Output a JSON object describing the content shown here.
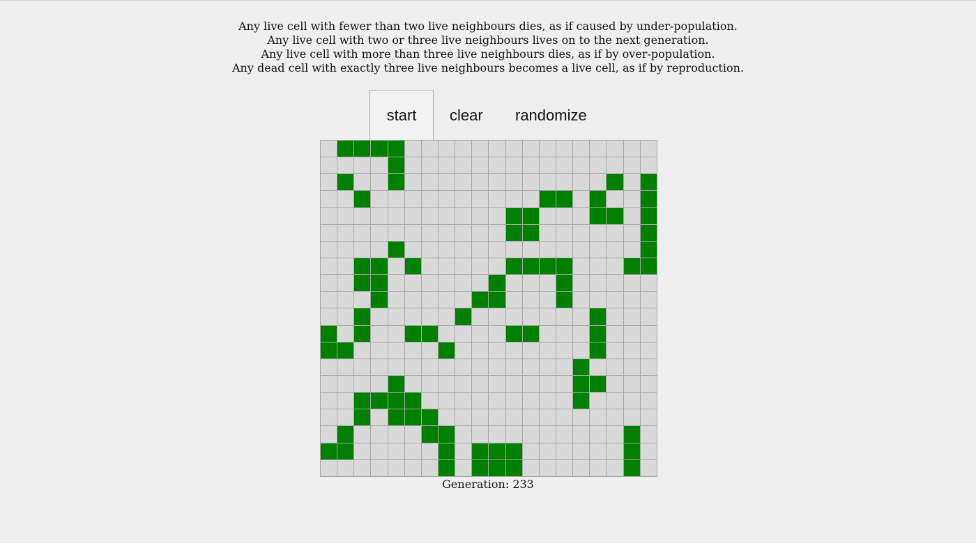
{
  "rules": [
    "Any live cell with fewer than two live neighbours dies, as if caused by under-population.",
    "Any live cell with two or three live neighbours lives on to the next generation.",
    "Any live cell with more than three live neighbours dies, as if by over-population.",
    "Any dead cell with exactly three live neighbours becomes a live cell, as if by reproduction."
  ],
  "controls": {
    "start_label": "start",
    "clear_label": "clear",
    "randomize_label": "randomize"
  },
  "board": {
    "rows": 20,
    "cols": 20,
    "alive_color": "#008000",
    "dead_color": "#d9d9d9",
    "grid_line_color": "#a6a6a6",
    "cells": [
      "01111000000000000000",
      "00001000000000000000",
      "01001000000000000101",
      "00100000000001101001",
      "00000000000110001101",
      "00000000000110000001",
      "00001000000000000001",
      "00110100000111100011",
      "00110000001000100000",
      "00010000011000100000",
      "00100000100000001000",
      "10100110000110001000",
      "11000001000000001000",
      "00000000000000010000",
      "00001000000000011000",
      "00111100000000010000",
      "00101110000000000000",
      "01000011000000000010",
      "11000001011100000010",
      "00000001011100000010"
    ]
  },
  "status": {
    "generation_text": "Generation: 233"
  }
}
